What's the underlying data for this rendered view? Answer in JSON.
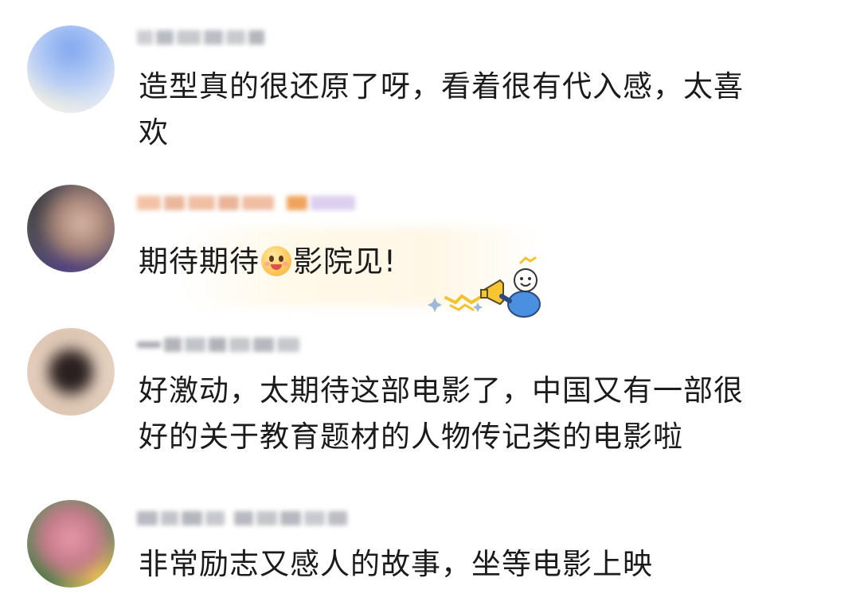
{
  "comments": [
    {
      "text_lines": [
        "造型真的很还原了呀，看着很有代入感，太喜",
        "欢"
      ]
    },
    {
      "text_before_emoji": "期待期待",
      "emoji": "grinning-face-emoji",
      "text_after_emoji": "影院见!",
      "decoration": "cheering-megaphone-sticker"
    },
    {
      "text_lines": [
        "好激动，太期待这部电影了，中国又有一部很",
        "好的关于教育题材的人物传记类的电影啦"
      ]
    },
    {
      "text_lines": [
        "非常励志又感人的故事，坐等电影上映"
      ]
    }
  ],
  "colors": {
    "text": "#1b1b1b",
    "background": "#ffffff",
    "sticker_blue": "#4a8fe0",
    "sticker_yellow": "#f7c531"
  }
}
